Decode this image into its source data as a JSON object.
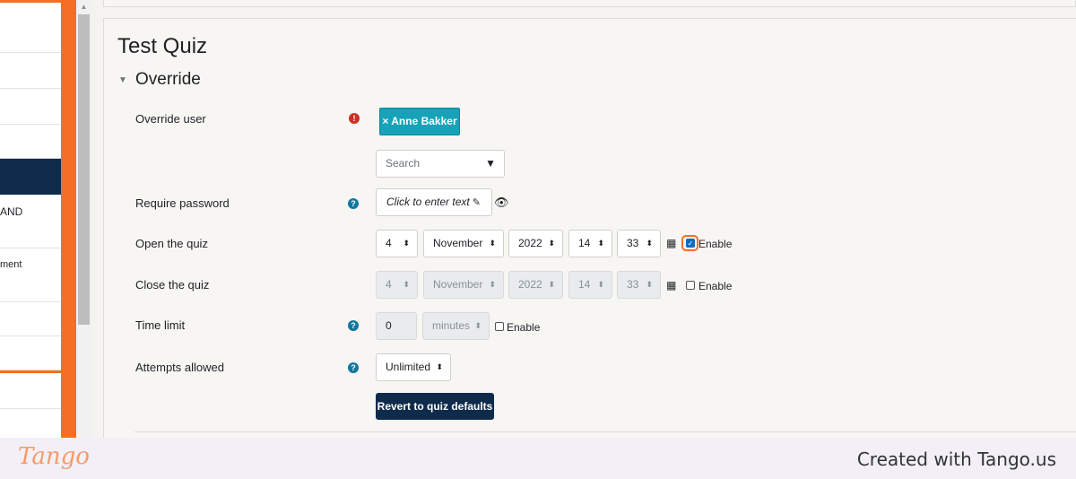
{
  "sidebar": {
    "items": [
      {
        "label": ""
      },
      {
        "label": ""
      },
      {
        "label": ""
      },
      {
        "label": ""
      },
      {
        "label": ""
      },
      {
        "label": "AND"
      },
      {
        "label": "ment"
      },
      {
        "label": ""
      },
      {
        "label": ""
      },
      {
        "label": ""
      }
    ]
  },
  "page": {
    "title": "Test Quiz",
    "section_title": "Override"
  },
  "form": {
    "override_user": {
      "label": "Override user",
      "selected_user": "× Anne Bakker",
      "search_placeholder": "Search"
    },
    "require_password": {
      "label": "Require password",
      "value": "Click to enter text"
    },
    "open_quiz": {
      "label": "Open the quiz",
      "day": "4",
      "month": "November",
      "year": "2022",
      "hour": "14",
      "minute": "33",
      "enable_label": "Enable",
      "enabled": true
    },
    "close_quiz": {
      "label": "Close the quiz",
      "day": "4",
      "month": "November",
      "year": "2022",
      "hour": "14",
      "minute": "33",
      "enable_label": "Enable",
      "enabled": false
    },
    "time_limit": {
      "label": "Time limit",
      "value": "0",
      "unit": "minutes",
      "enable_label": "Enable",
      "enabled": false
    },
    "attempts": {
      "label": "Attempts allowed",
      "value": "Unlimited"
    },
    "revert_button": "Revert to quiz defaults"
  },
  "footer": {
    "logo": "Tango",
    "text": "Created with Tango.us"
  },
  "colors": {
    "accent_orange": "#f46f25",
    "navy": "#0f2b4b",
    "teal_chip": "#17a2b8",
    "help_blue": "#1177a0",
    "error_red": "#ca3120"
  }
}
